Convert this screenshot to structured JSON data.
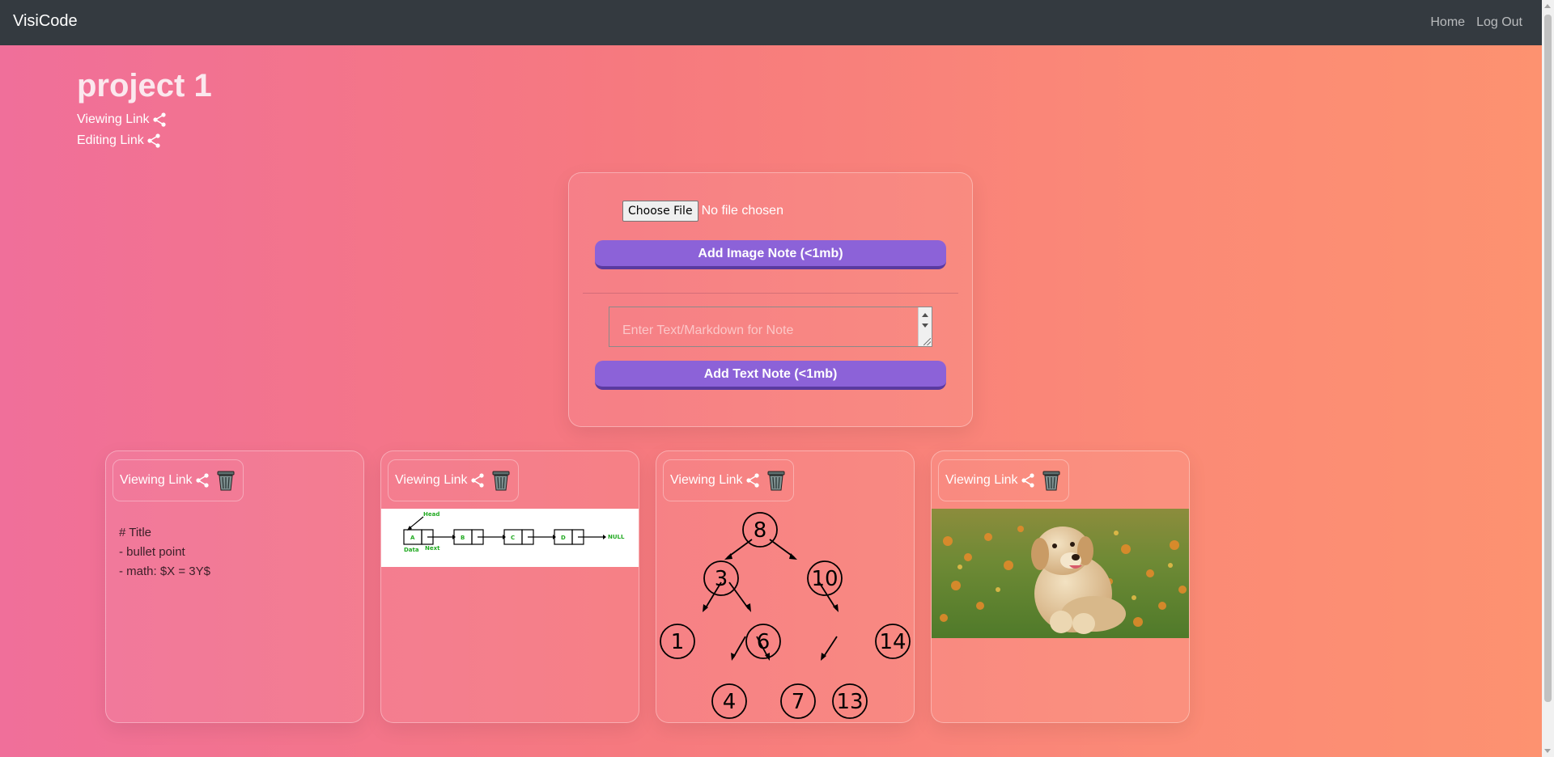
{
  "navbar": {
    "brand": "VisiCode",
    "links": [
      "Home",
      "Log Out"
    ]
  },
  "project": {
    "title": "project 1",
    "viewing_link": "Viewing Link",
    "editing_link": "Editing Link"
  },
  "form": {
    "file_button": "Choose File",
    "file_status": "No file chosen",
    "add_image_label": "Add Image Note (<1mb)",
    "text_placeholder": "Enter Text/Markdown for Note",
    "add_text_label": "Add Text Note (<1mb)"
  },
  "notes": [
    {
      "type": "text",
      "link_label": "Viewing Link",
      "lines": [
        "# Title",
        "- bullet point",
        "- math: $X = 3Y$"
      ]
    },
    {
      "type": "image",
      "link_label": "Viewing Link",
      "image": "linked-list-diagram",
      "labels": {
        "head": "Head",
        "a": "A",
        "b": "B",
        "c": "C",
        "d": "D",
        "null": "NULL",
        "data": "Data",
        "next": "Next"
      }
    },
    {
      "type": "image",
      "link_label": "Viewing Link",
      "image": "binary-search-tree-diagram",
      "nodes": [
        "8",
        "3",
        "10",
        "1",
        "6",
        "14",
        "4",
        "7",
        "13"
      ]
    },
    {
      "type": "image",
      "link_label": "Viewing Link",
      "image": "puppy-photo"
    }
  ],
  "icons": {
    "share": "share-icon",
    "trash": "trash-icon"
  },
  "colors": {
    "navbar": "#343a40",
    "button": "#8c62d8",
    "diagram_green": "#22aa22"
  }
}
